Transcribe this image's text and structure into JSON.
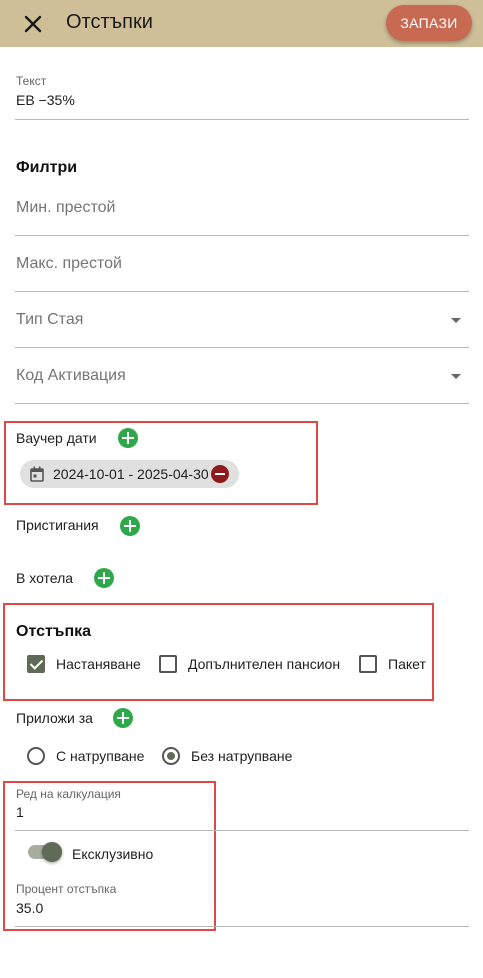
{
  "header": {
    "title": "Отстъпки",
    "save_label": "ЗАПАЗИ"
  },
  "text_field": {
    "label": "Текст",
    "value": "ЕВ −35%"
  },
  "filters": {
    "title": "Филтри",
    "min_stay_placeholder": "Мин. престой",
    "max_stay_placeholder": "Макс. престой",
    "room_type_placeholder": "Тип Стая",
    "activation_code_placeholder": "Код Активация",
    "voucher_dates_label": "Ваучер дати",
    "voucher_chip": "2024-10-01 - 2025-04-30",
    "arrivals_label": "Пристигания",
    "in_hotel_label": "В хотела"
  },
  "discount": {
    "title": "Отстъпка",
    "options": [
      {
        "label": "Настаняване",
        "checked": true
      },
      {
        "label": "Допълнителен пансион",
        "checked": false
      },
      {
        "label": "Пакет",
        "checked": false
      }
    ]
  },
  "apply_to": {
    "label": "Приложи за",
    "radio_stacking": "С натрупване",
    "radio_no_stacking": "Без натрупване",
    "selected": "Без натрупване"
  },
  "calc_order": {
    "label": "Ред на калкулация",
    "value": "1"
  },
  "exclusive": {
    "label": "Ексклузивно",
    "on": true
  },
  "percent": {
    "label": "Процент отстъпка",
    "value": "35.0"
  },
  "colors": {
    "topbar": "#cfbf99",
    "save_button": "#c86a52",
    "accent": "#5f6b56",
    "plus": "#2ea84a",
    "minus": "#8e1b1b",
    "highlight": "#e04848"
  }
}
